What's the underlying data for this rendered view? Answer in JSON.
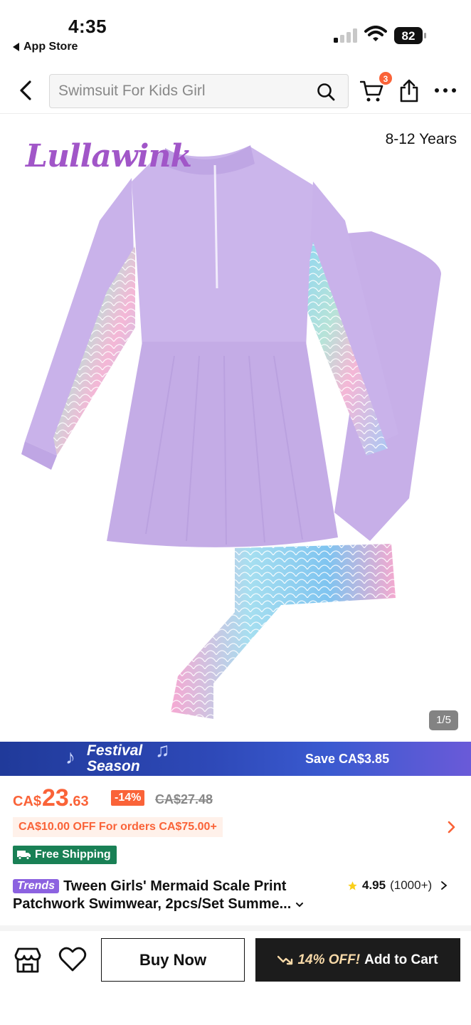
{
  "status_bar": {
    "time": "4:35",
    "back_label": "App Store",
    "battery": "82"
  },
  "header": {
    "search_placeholder": "Swimsuit For Kids Girl",
    "cart_count": "3"
  },
  "gallery": {
    "brand": "Lullawink",
    "age_range": "8-12 Years",
    "counter": "1/5"
  },
  "festival": {
    "title_line1": "Festival",
    "title_line2": "Season",
    "save_text": "Save CA$3.85"
  },
  "price": {
    "currency": "CA$",
    "integer": "23",
    "decimal": ".63",
    "discount": "-14%",
    "original": "CA$27.48"
  },
  "coupon": "CA$10.00 OFF For orders CA$75.00+",
  "shipping": "Free Shipping",
  "product": {
    "trends_badge": "Trends",
    "title": "Tween Girls' Mermaid Scale Print Patchwork Swimwear, 2pcs/Set Summe...",
    "rating": "4.95",
    "review_count": "(1000+)"
  },
  "actions": {
    "buy_now": "Buy Now",
    "add_cart_promo": "14% OFF!",
    "add_cart": "Add to Cart"
  },
  "colors": {
    "accent": "#fa6338",
    "shipping_green": "#198055",
    "brand_purple": "#a156c8",
    "garment_lavender": "#c9b2ea"
  }
}
